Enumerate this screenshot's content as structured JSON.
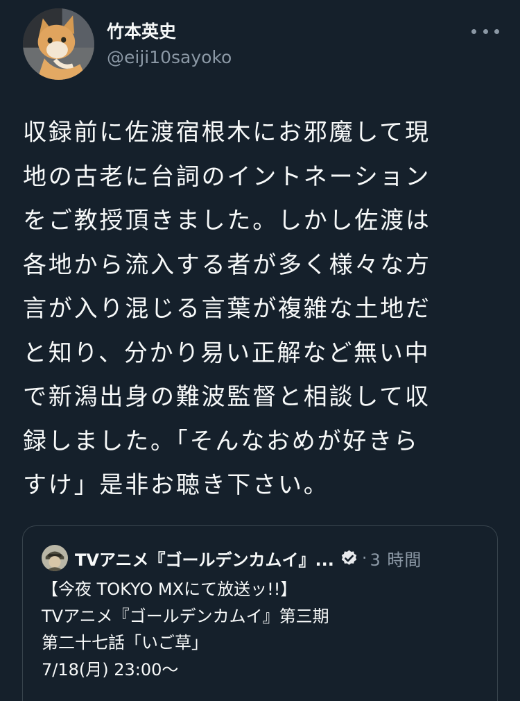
{
  "author": {
    "display_name": "竹本英史",
    "handle": "@eiji10sayoko"
  },
  "tweet": {
    "text": "収録前に佐渡宿根木にお邪魔して現\n地の古老に台詞のイントネーション\nをご教授頂きました。しかし佐渡は\n各地から流入する者が多く様々な方\n言が入り混じる言葉が複雑な土地だ\nと知り、分かり易い正解など無い中\nで新潟出身の難波監督と相談して収\n録しました。「そんなおめが好きら\nすけ」是非お聴き下さい。"
  },
  "quoted_tweet": {
    "display_name": "TVアニメ『ゴールデンカムイ』...",
    "separator": "·",
    "time": "3 時間",
    "text": "【今夜 TOKYO MXにて放送ッ!!】\nTVアニメ『ゴールデンカムイ』第三期\n第二十七話「いご草」\n7/18(月) 23:00〜"
  },
  "icons": {
    "more": "more-horizontal-icon",
    "verified": "verified-badge-icon",
    "avatar": "cat-avatar",
    "quote_avatar": "anime-character-avatar"
  },
  "colors": {
    "background": "#15202b",
    "text": "#f7f9f9",
    "secondary": "#8b98a5",
    "border": "#38444d"
  }
}
